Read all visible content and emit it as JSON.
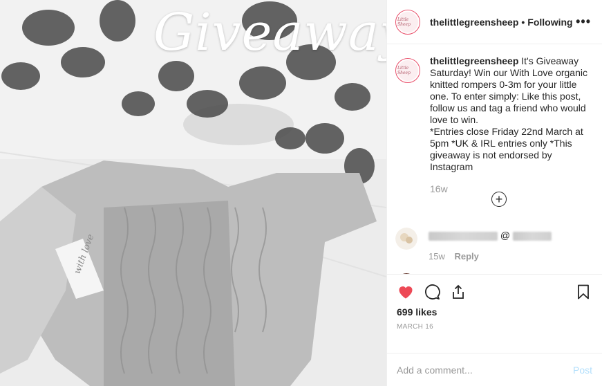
{
  "post": {
    "image_overlay_text": "Giveaway",
    "tag_text": "with love"
  },
  "header": {
    "avatar_text": "Little Sheep",
    "username": "thelittlegreensheep",
    "separator": "•",
    "follow_status": "Following",
    "more_label": "•••"
  },
  "caption": {
    "username": "thelittlegreensheep",
    "text": "It's Giveaway Saturday! Win our With Love organic knitted rompers 0-3m for your little one. To enter simply: Like this post, follow us and tag a friend who would love to win.\n*Entries close Friday 22nd March at 5pm *UK & IRL entries only *This giveaway is not endorsed by Instagram",
    "time": "16w"
  },
  "load_more_label": "+",
  "comments": [
    {
      "at": "@",
      "time": "15w",
      "reply_label": "Reply"
    },
    {
      "at": "@"
    }
  ],
  "actions": {
    "likes": "699 likes",
    "date": "MARCH 16"
  },
  "add_comment": {
    "placeholder": "Add a comment...",
    "post_label": "Post"
  },
  "colors": {
    "like_red": "#ed4956",
    "avatar_ring": "#e94f6a",
    "post_button_disabled": "#b2dffc"
  }
}
